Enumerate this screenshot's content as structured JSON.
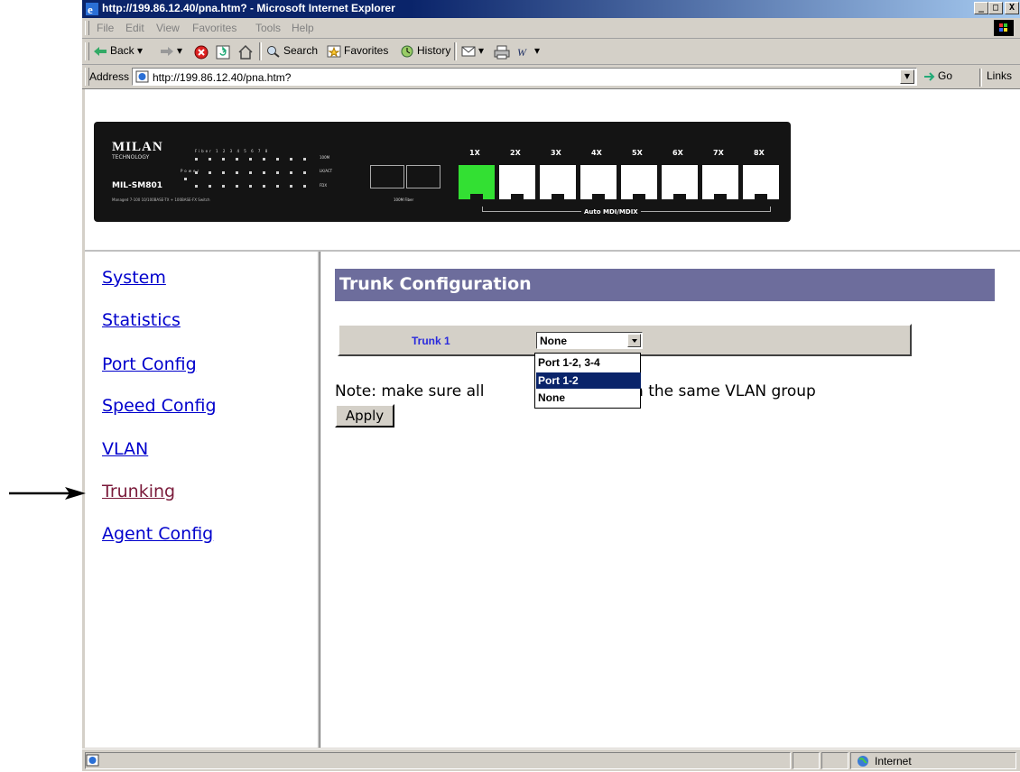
{
  "window": {
    "title": "http://199.86.12.40/pna.htm? - Microsoft Internet Explorer",
    "minimize": "_",
    "restore": "□",
    "close": "X"
  },
  "menu": [
    "File",
    "Edit",
    "View",
    "Favorites",
    "Tools",
    "Help"
  ],
  "toolbar": {
    "back": "Back",
    "search": "Search",
    "favorites": "Favorites",
    "history": "History"
  },
  "address": {
    "label": "Address",
    "url": "http://199.86.12.40/pna.htm?",
    "go": "Go",
    "links": "Links"
  },
  "banner": {
    "brand": "MILAN",
    "brand_sub": "TECHNOLOGY",
    "model": "MIL-SM801",
    "description": "Managed 7-100 10/100BASE-TX + 100BASE-FX Switch",
    "led_header": "Fiber 1  2  3  4  5  6  7  8",
    "led_row1": "100M",
    "led_row2": "LK/ACT",
    "led_row3": "FDX",
    "power": "Power",
    "fiber_label": "100M Fiber",
    "ports": [
      "1X",
      "2X",
      "3X",
      "4X",
      "5X",
      "6X",
      "7X",
      "8X"
    ],
    "mdi": "Auto MDI/MDIX"
  },
  "nav": [
    {
      "label": "System",
      "visited": false
    },
    {
      "label": "Statistics",
      "visited": false
    },
    {
      "label": "Port Config",
      "visited": false
    },
    {
      "label": "Speed Config",
      "visited": false
    },
    {
      "label": "VLAN",
      "visited": false
    },
    {
      "label": "Trunking",
      "visited": true
    },
    {
      "label": "Agent Config",
      "visited": false
    }
  ],
  "main": {
    "heading": "Trunk Configuration",
    "trunk_label": "Trunk 1",
    "select_value": "None",
    "options": [
      "Port 1-2, 3-4",
      "Port 1-2",
      "None"
    ],
    "highlighted_option": "Port 1-2",
    "note_prefix": "Note: make sure all",
    "note_suffix": "are in the same VLAN group",
    "apply": "Apply"
  },
  "status": {
    "zone": "Internet"
  },
  "colors": {
    "heading_bg": "#6d6d9c",
    "link": "#0000cc",
    "visited_link": "#7a1a3a",
    "selection": "#0a246a",
    "active_port": "#33e033"
  }
}
